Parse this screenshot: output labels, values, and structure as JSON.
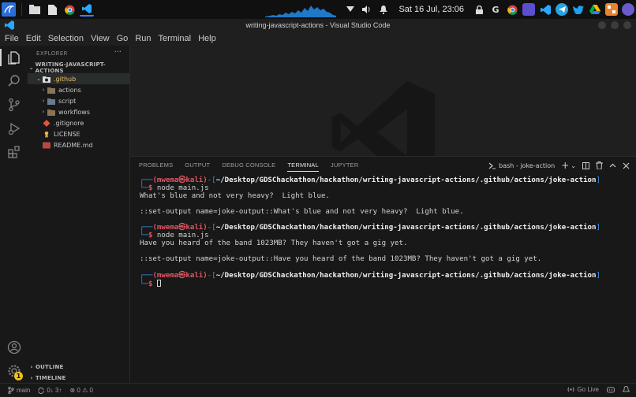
{
  "system_bar": {
    "clock": "Sat 16 Jul, 23:06",
    "left_icons": [
      "kali-menu-icon",
      "folder-icon",
      "files-icon",
      "chrome-icon",
      "vscode-icon"
    ],
    "tray_icons": [
      "chevron-down-icon",
      "volume-icon",
      "bell-icon",
      "lock-icon",
      "google-icon",
      "chrome-icon",
      "screen-icon",
      "vscode-icon",
      "telegram-icon",
      "twitter-icon",
      "drive-icon",
      "app-icon",
      "avatar-icon"
    ]
  },
  "window": {
    "title": "writing-javascript-actions - Visual Studio Code"
  },
  "menu": [
    "File",
    "Edit",
    "Selection",
    "View",
    "Go",
    "Run",
    "Terminal",
    "Help"
  ],
  "sidebar": {
    "title": "EXPLORER",
    "more": "···",
    "project": "WRITING-JAVASCRIPT-ACTIONS",
    "tree": [
      {
        "label": ".github",
        "type": "folder-open",
        "icon": "github-folder-icon"
      },
      {
        "label": "actions",
        "type": "folder",
        "icon": "folder-icon"
      },
      {
        "label": "script",
        "type": "folder",
        "icon": "folder-icon"
      },
      {
        "label": "workflows",
        "type": "folder",
        "icon": "folder-icon"
      },
      {
        "label": ".gitignore",
        "type": "file",
        "icon": "git-icon"
      },
      {
        "label": "LICENSE",
        "type": "file",
        "icon": "license-icon"
      },
      {
        "label": "README.md",
        "type": "file",
        "icon": "markdown-icon"
      }
    ],
    "outline": "OUTLINE",
    "timeline": "TIMELINE"
  },
  "activity": {
    "accounts_badge": "1"
  },
  "panel": {
    "tabs": [
      "PROBLEMS",
      "OUTPUT",
      "DEBUG CONSOLE",
      "TERMINAL",
      "JUPYTER"
    ],
    "active_tab": "TERMINAL",
    "terminal_name": "bash - joke-action",
    "plus": "+",
    "chevron": "⌄",
    "prompt_user": "(mwema㉿kali)",
    "prompt_path": "~/Desktop/GDSChackathon/hackathon/writing-javascript-actions/.github/actions/joke-action",
    "command": "node main.js",
    "outputs": [
      "What's blue and not very heavy?  Light blue.",
      "::set-output name=joke-output::What's blue and not very heavy?  Light blue.",
      "Have you heard of the band 1023MB? They haven't got a gig yet.",
      "::set-output name=joke-output::Have you heard of the band 1023MB? They haven't got a gig yet."
    ]
  },
  "status": {
    "branch": "main",
    "sync": "0↓ 3↑",
    "problems": "⊗ 0 ⚠ 0",
    "go_live": "Go Live"
  },
  "colors": {
    "accent": "#3b8eea",
    "prompt": "#e05561",
    "badge": "#f0c419"
  }
}
